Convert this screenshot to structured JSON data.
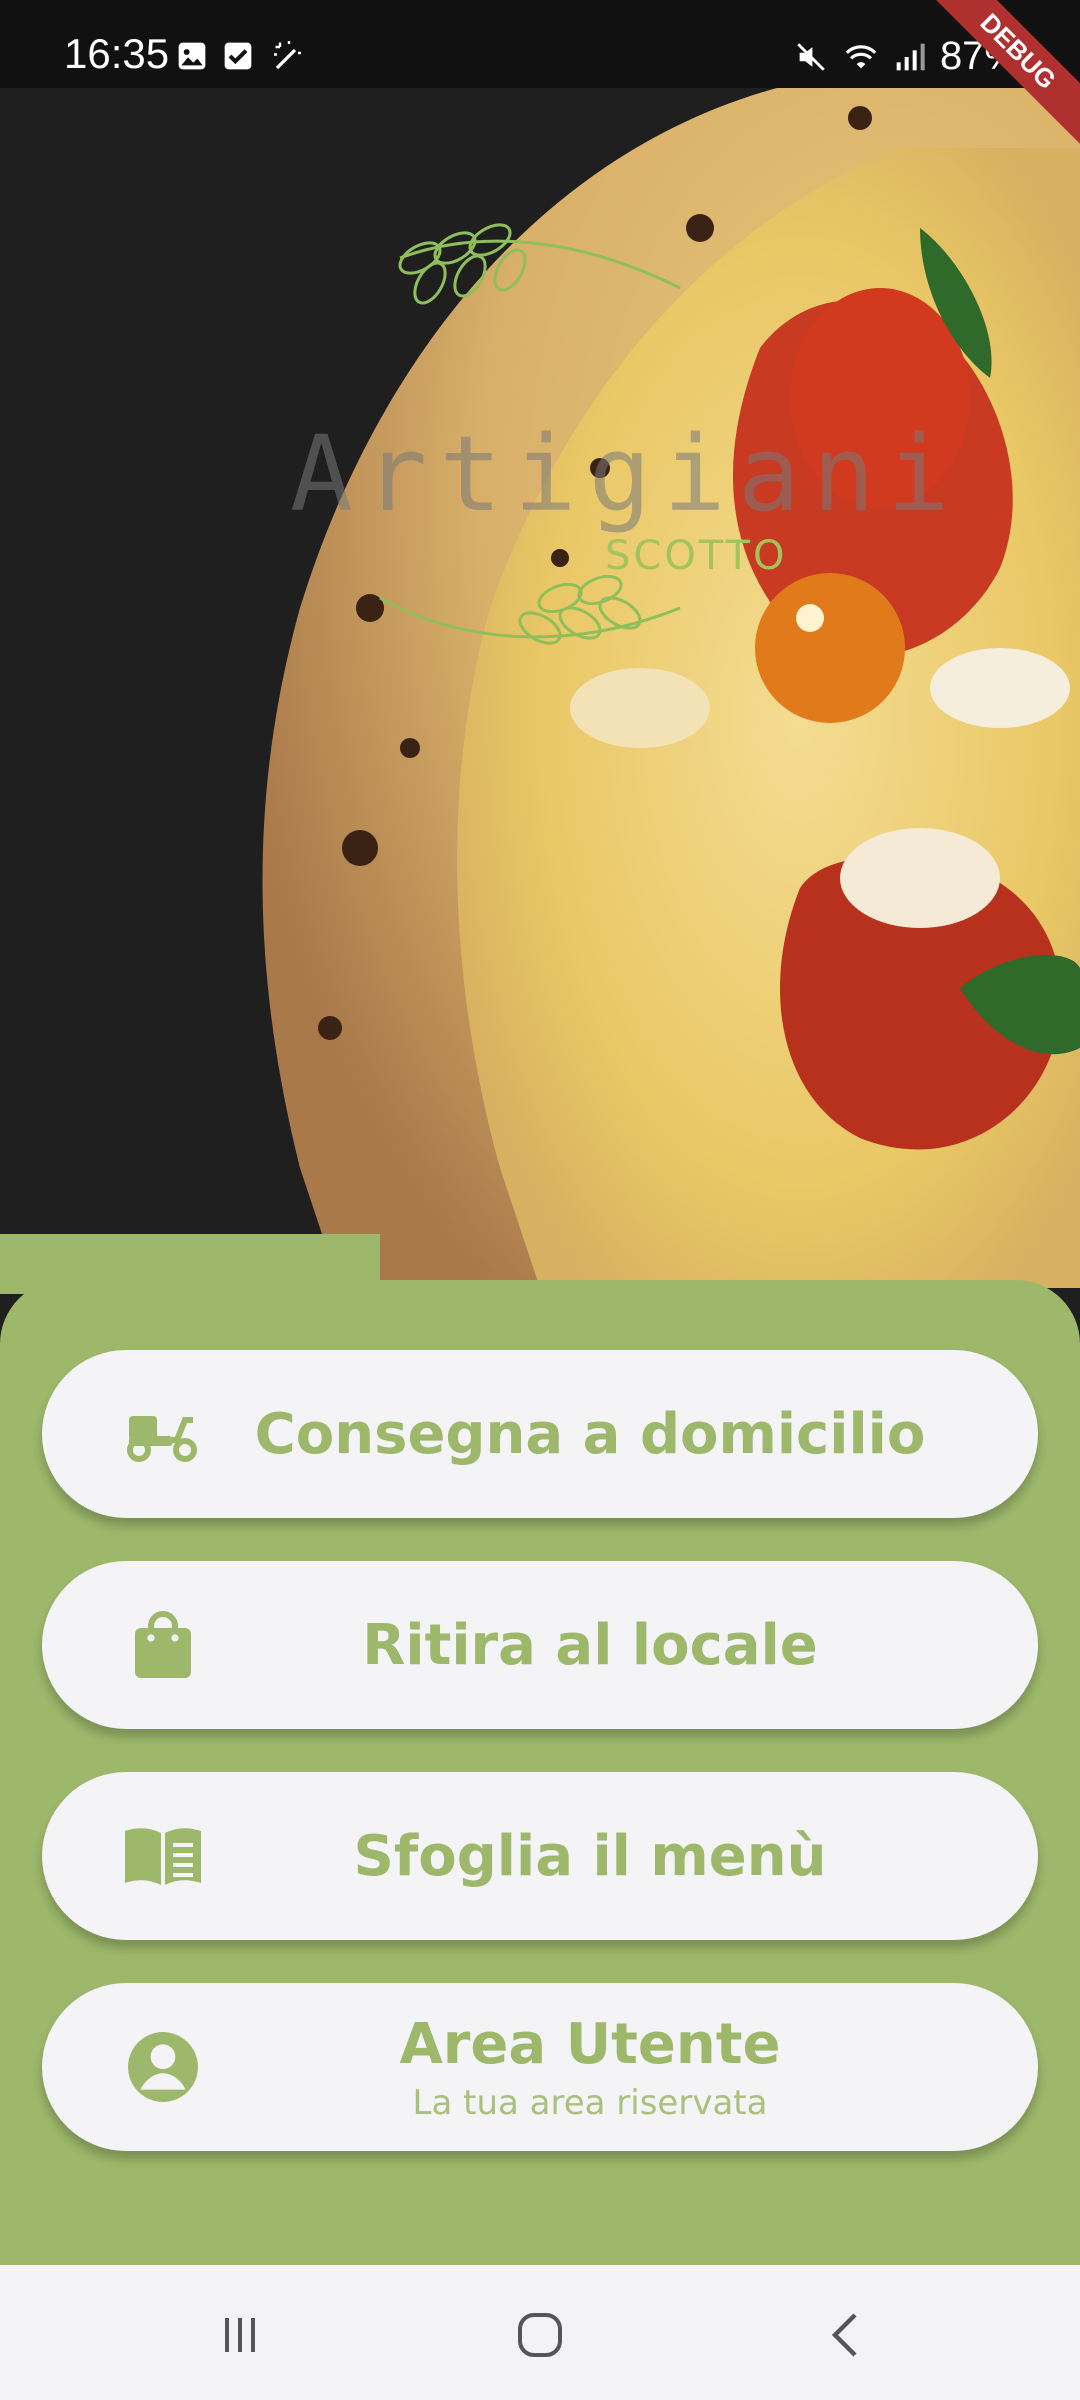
{
  "status_bar": {
    "time": "16:35",
    "battery": "87%",
    "debug_banner": "DEBUG"
  },
  "logo": {
    "title": "Artigiani",
    "subtitle": "SCOTTO"
  },
  "actions": [
    {
      "label": "Consegna a domicilio",
      "icon": "scooter-icon"
    },
    {
      "label": "Ritira al locale",
      "icon": "shopping-bag-icon"
    },
    {
      "label": "Sfoglia il menù",
      "icon": "menu-book-icon"
    },
    {
      "label": "Area Utente",
      "sublabel": "La tua area riservata",
      "icon": "account-circle-icon"
    }
  ],
  "colors": {
    "brand_green": "#9db86b",
    "button_bg": "#f4f4f7",
    "dark_bg": "#1f1f1f"
  }
}
